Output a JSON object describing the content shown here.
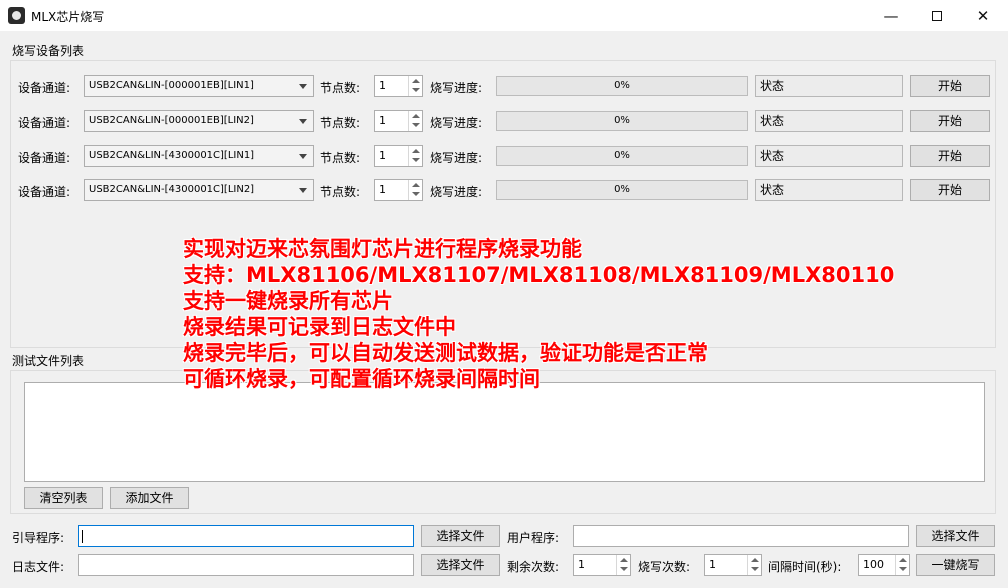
{
  "window": {
    "title": "MLX芯片烧写",
    "min_icon": "minimize-icon",
    "max_icon": "maximize-icon",
    "close_icon": "close-icon"
  },
  "device_group": {
    "title": "烧写设备列表",
    "channel_label": "设备通道:",
    "node_label": "节点数:",
    "progress_label": "烧写进度:",
    "rows": [
      {
        "channel": "USB2CAN&LIN-[000001EB][LIN1]",
        "nodes": "1",
        "progress_text": "0%",
        "progress": 0,
        "status": "状态",
        "start": "开始"
      },
      {
        "channel": "USB2CAN&LIN-[000001EB][LIN2]",
        "nodes": "1",
        "progress_text": "0%",
        "progress": 0,
        "status": "状态",
        "start": "开始"
      },
      {
        "channel": "USB2CAN&LIN-[4300001C][LIN1]",
        "nodes": "1",
        "progress_text": "0%",
        "progress": 0,
        "status": "状态",
        "start": "开始"
      },
      {
        "channel": "USB2CAN&LIN-[4300001C][LIN2]",
        "nodes": "1",
        "progress_text": "0%",
        "progress": 0,
        "status": "状态",
        "start": "开始"
      }
    ]
  },
  "file_group": {
    "title": "测试文件列表",
    "clear_button": "清空列表",
    "add_button": "添加文件"
  },
  "bottom": {
    "boot_label": "引导程序:",
    "boot_value": "",
    "select_file_1": "选择文件",
    "user_label": "用户程序:",
    "user_value": "",
    "select_file_2": "选择文件",
    "log_label": "日志文件:",
    "log_value": "",
    "select_file_3": "选择文件",
    "remain_label": "剩余次数:",
    "remain_value": "1",
    "burn_count_label": "烧写次数:",
    "burn_count_value": "1",
    "interval_label": "间隔时间(秒):",
    "interval_value": "100",
    "one_key_button": "一键烧写"
  },
  "overlay_lines": [
    "实现对迈来芯氛围灯芯片进行程序烧录功能",
    "支持：MLX81106/MLX81107/MLX81108/MLX81109/MLX80110",
    "支持一键烧录所有芯片",
    "烧录结果可记录到日志文件中",
    "烧录完毕后，可以自动发送测试数据，验证功能是否正常",
    "可循环烧录，可配置循环烧录间隔时间"
  ],
  "colors": {
    "overlay_text": "#ff0000",
    "progress_fill": "#06b025",
    "focus_border": "#0078d7"
  }
}
